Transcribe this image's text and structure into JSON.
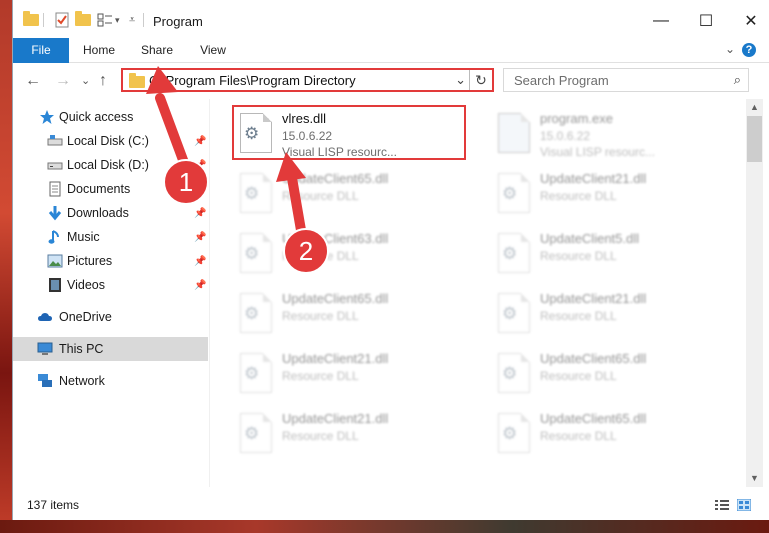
{
  "window": {
    "title": "Program",
    "controls": {
      "minimize": "—",
      "maximize": "☐",
      "close": "✕"
    }
  },
  "ribbon": {
    "tabs": [
      "File",
      "Home",
      "Share",
      "View"
    ],
    "expand": "⌄",
    "help": "?"
  },
  "nav": {
    "back": "←",
    "forward": "→",
    "recent": "⌄",
    "up": "↑",
    "address_path": "C:\\Program Files\\Program Directory",
    "address_dropdown": "⌄",
    "refresh": "↻",
    "search_placeholder": "Search Program",
    "search_icon": "⌕"
  },
  "sidebar": {
    "items": [
      {
        "label": "Quick access",
        "icon": "star-icon"
      },
      {
        "label": "Local Disk (C:)",
        "icon": "drive-icon",
        "pinned": true
      },
      {
        "label": "Local Disk (D:)",
        "icon": "drive-icon",
        "pinned": true
      },
      {
        "label": "Documents",
        "icon": "documents-icon",
        "pinned": true
      },
      {
        "label": "Downloads",
        "icon": "download-icon",
        "pinned": true
      },
      {
        "label": "Music",
        "icon": "music-icon",
        "pinned": true
      },
      {
        "label": "Pictures",
        "icon": "pictures-icon",
        "pinned": true
      },
      {
        "label": "Videos",
        "icon": "videos-icon",
        "pinned": true
      },
      {
        "label": "OneDrive",
        "icon": "cloud-icon"
      },
      {
        "label": "This PC",
        "icon": "computer-icon",
        "selected": true
      },
      {
        "label": "Network",
        "icon": "network-icon"
      }
    ]
  },
  "files": [
    {
      "name": "vlres.dll",
      "version": "15.0.6.22",
      "description": "Visual LISP resourc...",
      "highlighted": true
    },
    {
      "name": "program.exe",
      "version": "15.0.6.22",
      "description": "Visual LISP resourc..."
    },
    {
      "name": "UpdateClient65.dll",
      "description": "Resource DLL"
    },
    {
      "name": "UpdateClient21.dll",
      "description": "Resource DLL"
    },
    {
      "name": "UpdateClient63.dll",
      "description": "Resource DLL"
    },
    {
      "name": "UpdateClient5.dll",
      "description": "Resource DLL"
    },
    {
      "name": "UpdateClient65.dll",
      "description": "Resource DLL"
    },
    {
      "name": "UpdateClient21.dll",
      "description": "Resource DLL"
    },
    {
      "name": "UpdateClient21.dll",
      "description": "Resource DLL"
    },
    {
      "name": "UpdateClient65.dll",
      "description": "Resource DLL"
    },
    {
      "name": "UpdateClient21.dll",
      "description": "Resource DLL"
    },
    {
      "name": "UpdateClient65.dll",
      "description": "Resource DLL"
    }
  ],
  "status": {
    "item_count": "137 items"
  },
  "annotations": {
    "step1": "1",
    "step2": "2"
  },
  "colors": {
    "accent": "#1979ca",
    "annotation_red": "#e23a3a",
    "selection": "#d9d9d9"
  }
}
